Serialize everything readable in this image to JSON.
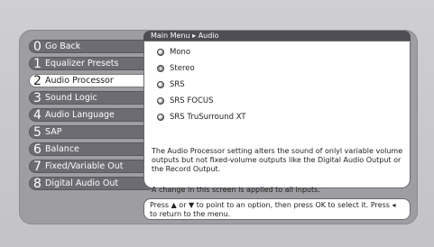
{
  "header": {
    "breadcrumb": "Main Menu ▸ Audio"
  },
  "menu": {
    "items": [
      {
        "num": "0",
        "label": "Go Back"
      },
      {
        "num": "1",
        "label": "Equalizer Presets"
      },
      {
        "num": "2",
        "label": "Audio Processor"
      },
      {
        "num": "3",
        "label": "Sound Logic"
      },
      {
        "num": "4",
        "label": "Audio Language"
      },
      {
        "num": "5",
        "label": "SAP"
      },
      {
        "num": "6",
        "label": "Balance"
      },
      {
        "num": "7",
        "label": "Fixed/Variable Out"
      },
      {
        "num": "8",
        "label": "Digital Audio Out"
      }
    ],
    "selected_index": 2
  },
  "options": {
    "items": [
      "Mono",
      "Stereo",
      "SRS",
      "SRS FOCUS",
      "SRS TruSurround XT"
    ]
  },
  "description": "The Audio Processor setting alters the sound of onlyl variable volume outputs but not fixed-volume outputs like the Digital Audio Output or the Record Output.",
  "note": "A change in this screen is applied to all inputs.",
  "hint": "Press ▲ or ▼ to point to an option, then press OK to select it. Press ◂ to return to the menu.",
  "colors": {
    "panel": "#9d9da2",
    "menu_item": "#6c6c72",
    "title_bar": "#4e4e54",
    "content_bg": "#ffffff"
  }
}
